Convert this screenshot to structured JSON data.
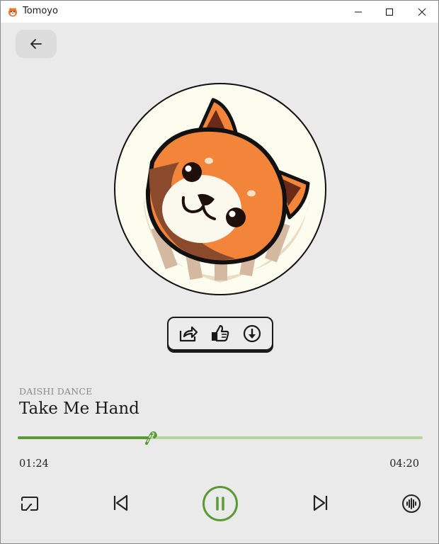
{
  "window": {
    "title": "Tomoyo",
    "icon": "red-panda-icon"
  },
  "nav": {
    "back_icon": "arrow-left-icon"
  },
  "cover": {
    "art": "red-panda-artwork"
  },
  "actions": [
    {
      "name": "share-icon"
    },
    {
      "name": "thumbs-up-icon"
    },
    {
      "name": "download-icon"
    }
  ],
  "track": {
    "artist": "DAISHI DANCE",
    "title": "Take Me Hand"
  },
  "progress": {
    "elapsed": "01:24",
    "total": "04:20",
    "fraction": 0.323
  },
  "controls": {
    "cast_icon": "cast-icon",
    "prev_icon": "skip-previous-icon",
    "play_icon": "pause-icon",
    "next_icon": "skip-next-icon",
    "eq_icon": "audio-waveform-icon"
  },
  "colors": {
    "accent": "#5a9a35",
    "track_bg": "#b6d49d",
    "background": "#eaeaea"
  }
}
